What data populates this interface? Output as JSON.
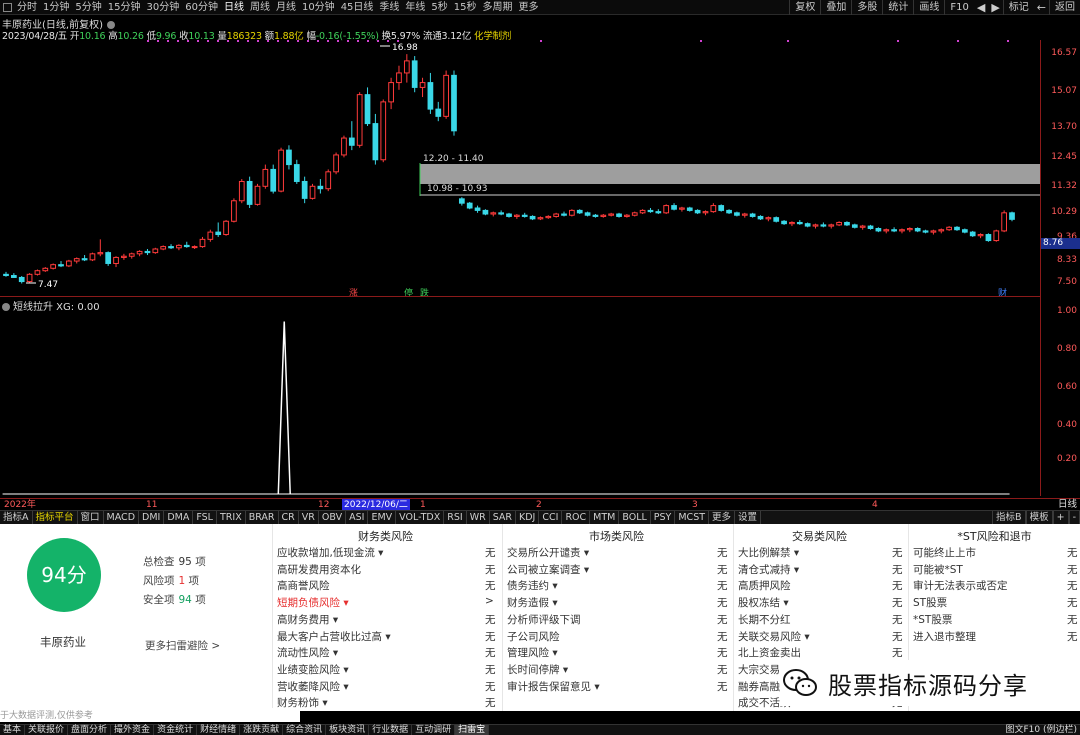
{
  "toolbar": {
    "periods": [
      "分时",
      "1分钟",
      "5分钟",
      "15分钟",
      "30分钟",
      "60分钟",
      "日线",
      "周线",
      "月线",
      "10分钟",
      "45日线",
      "季线",
      "年线",
      "5秒",
      "15秒",
      "多周期",
      "更多"
    ],
    "active_period": "日线",
    "right_buttons": [
      "复权",
      "叠加",
      "多股",
      "统计",
      "画线",
      "F10",
      "标记",
      "返回"
    ]
  },
  "stock": {
    "title": "丰原药业(日线,前复权)",
    "info": {
      "date": "2023/04/28/五",
      "open_label": "开",
      "open": "10.16",
      "high_label": "高",
      "high": "10.26",
      "low_label": "低",
      "low": "9.96",
      "close_label": "收",
      "close": "10.13",
      "vol_label": "量",
      "vol": "186323",
      "amt_label": "额",
      "amt": "1.88亿",
      "chg_label": "幅",
      "chg": "-0.16(-1.55%)",
      "turn_label": "换",
      "turn": "5.97%",
      "float_label": "流通",
      "float": "3.12亿",
      "sector": "化学制剂"
    },
    "price_high_marker": "16.98",
    "price_low_marker": "7.47",
    "zone_upper_label": "12.20 - 11.40",
    "zone_lower_label": "10.98 - 10.93",
    "current_price": "8.76",
    "event_markers": [
      {
        "text": "涨",
        "color": "#ff4040"
      },
      {
        "text": "停",
        "color": "#3fd15a"
      },
      {
        "text": "跌",
        "color": "#3fd15a"
      },
      {
        "text": "财",
        "color": "#4080ff"
      }
    ]
  },
  "y_axis": [
    "16.57",
    "15.07",
    "13.70",
    "12.45",
    "11.32",
    "10.29",
    "9.36",
    "8.33",
    "7.50"
  ],
  "sub_chart": {
    "title": "短线拉升 XG: 0.00",
    "y_axis": [
      "1.00",
      "0.80",
      "0.60",
      "0.40",
      "0.20"
    ]
  },
  "date_axis": {
    "labels": [
      "2022年",
      "11",
      "12",
      "1",
      "2",
      "3",
      "4"
    ],
    "highlight": "2022/12/06/二",
    "unit": "日线"
  },
  "indicator_tabs": [
    "指标A",
    "指标平台",
    "窗口",
    "MACD",
    "DMI",
    "DMA",
    "FSL",
    "TRIX",
    "BRAR",
    "CR",
    "VR",
    "OBV",
    "ASI",
    "EMV",
    "VOL-TDX",
    "RSI",
    "WR",
    "SAR",
    "KDJ",
    "CCI",
    "ROC",
    "MTM",
    "BOLL",
    "PSY",
    "MCST",
    "更多",
    "设置"
  ],
  "indicator_tabs_right": [
    "指标B",
    "模板",
    "+",
    "-"
  ],
  "risk_panel": {
    "score": "94分",
    "company": "丰原药业",
    "total_label": "总检查",
    "total": "95",
    "total_unit": "项",
    "risk_label": "风险项",
    "risk": "1",
    "risk_unit": "项",
    "safe_label": "安全项",
    "safe": "94",
    "safe_unit": "项",
    "more": "更多扫雷避险 >",
    "disclaimer": "于大数据评测,仅供参考",
    "columns": [
      {
        "title": "财务类风险",
        "items": [
          {
            "label": "应收款增加,低现金流 ▾",
            "value": "无"
          },
          {
            "label": "高研发费用资本化",
            "value": "无"
          },
          {
            "label": "高商誉风险",
            "value": "无"
          },
          {
            "label": "短期负债风险 ▾",
            "value": ">",
            "alert": true
          },
          {
            "label": "高财务费用 ▾",
            "value": "无"
          },
          {
            "label": "最大客户占营收比过高 ▾",
            "value": "无"
          },
          {
            "label": "流动性风险 ▾",
            "value": "无"
          },
          {
            "label": "业绩变脸风险 ▾",
            "value": "无"
          },
          {
            "label": "营收萎降风险 ▾",
            "value": "无"
          },
          {
            "label": "财务粉饰 ▾",
            "value": "无"
          }
        ]
      },
      {
        "title": "市场类风险",
        "items": [
          {
            "label": "交易所公开谴责 ▾",
            "value": "无"
          },
          {
            "label": "公司被立案调查 ▾",
            "value": "无"
          },
          {
            "label": "债务违约 ▾",
            "value": "无"
          },
          {
            "label": "财务造假 ▾",
            "value": "无"
          },
          {
            "label": "分析师评级下调",
            "value": "无"
          },
          {
            "label": "子公司风险",
            "value": "无"
          },
          {
            "label": "管理风险 ▾",
            "value": "无"
          },
          {
            "label": "长时间停牌 ▾",
            "value": "无"
          },
          {
            "label": "审计报告保留意见 ▾",
            "value": "无"
          }
        ]
      },
      {
        "title": "交易类风险",
        "items": [
          {
            "label": "大比例解禁 ▾",
            "value": "无"
          },
          {
            "label": "清仓式减持 ▾",
            "value": "无"
          },
          {
            "label": "高质押风险",
            "value": "无"
          },
          {
            "label": "股权冻结 ▾",
            "value": "无"
          },
          {
            "label": "长期不分红",
            "value": "无"
          },
          {
            "label": "关联交易风险 ▾",
            "value": "无"
          },
          {
            "label": "北上资金卖出",
            "value": "无"
          },
          {
            "label": "大宗交易",
            "value": "无"
          },
          {
            "label": "融券高融",
            "value": "无"
          },
          {
            "label": "成交不活跃 ▾",
            "value": "无"
          }
        ]
      },
      {
        "title": "*ST风险和退市",
        "items": [
          {
            "label": "可能终止上市",
            "value": "无"
          },
          {
            "label": "可能被*ST",
            "value": "无"
          },
          {
            "label": "审计无法表示或否定",
            "value": "无"
          },
          {
            "label": "ST股票",
            "value": "无"
          },
          {
            "label": "*ST股票",
            "value": "无"
          },
          {
            "label": "进入退市整理",
            "value": "无"
          }
        ]
      }
    ]
  },
  "watermark": "股票指标源码分享",
  "status_bar": [
    "基本",
    "关联报价",
    "盘面分析",
    "撮外资金",
    "资金统计",
    "财经情绪",
    "涨跌贡献",
    "综合资讯",
    "板块资讯",
    "行业数据",
    "互动调研",
    "扫雷宝"
  ],
  "status_active": "扫雷宝",
  "status_right": "图文F10 (例边栏)",
  "chart_data": {
    "type": "candlestick",
    "title": "丰原药业(日线,前复权)",
    "ylim": [
      7.2,
      17.4
    ],
    "y_ticks": [
      16.57,
      15.07,
      13.7,
      12.45,
      11.32,
      10.29,
      9.36,
      8.33,
      7.5
    ],
    "candles": [
      [
        7.85,
        7.95,
        7.75,
        7.8
      ],
      [
        7.8,
        7.9,
        7.7,
        7.72
      ],
      [
        7.72,
        7.78,
        7.47,
        7.55
      ],
      [
        7.55,
        7.9,
        7.5,
        7.85
      ],
      [
        7.85,
        8.05,
        7.8,
        8.0
      ],
      [
        8.0,
        8.15,
        7.95,
        8.1
      ],
      [
        8.1,
        8.3,
        8.05,
        8.25
      ],
      [
        8.25,
        8.4,
        8.15,
        8.2
      ],
      [
        8.2,
        8.45,
        8.15,
        8.4
      ],
      [
        8.4,
        8.55,
        8.3,
        8.5
      ],
      [
        8.5,
        8.65,
        8.4,
        8.45
      ],
      [
        8.45,
        8.75,
        8.4,
        8.7
      ],
      [
        8.7,
        9.3,
        8.6,
        8.75
      ],
      [
        8.75,
        8.8,
        8.2,
        8.3
      ],
      [
        8.3,
        8.6,
        8.15,
        8.55
      ],
      [
        8.55,
        8.7,
        8.45,
        8.6
      ],
      [
        8.6,
        8.75,
        8.5,
        8.7
      ],
      [
        8.7,
        8.85,
        8.6,
        8.8
      ],
      [
        8.8,
        8.9,
        8.65,
        8.75
      ],
      [
        8.75,
        8.95,
        8.7,
        8.9
      ],
      [
        8.9,
        9.05,
        8.85,
        9.0
      ],
      [
        9.0,
        9.1,
        8.9,
        8.95
      ],
      [
        8.95,
        9.1,
        8.85,
        9.05
      ],
      [
        9.05,
        9.2,
        8.95,
        9.0
      ],
      [
        9.0,
        9.05,
        8.9,
        9.0
      ],
      [
        9.0,
        9.4,
        8.95,
        9.3
      ],
      [
        9.3,
        9.7,
        9.2,
        9.6
      ],
      [
        9.6,
        10.0,
        9.4,
        9.5
      ],
      [
        9.5,
        10.1,
        9.45,
        10.05
      ],
      [
        10.05,
        11.0,
        10.0,
        10.9
      ],
      [
        10.9,
        11.8,
        10.8,
        11.7
      ],
      [
        11.7,
        11.9,
        10.6,
        10.75
      ],
      [
        10.75,
        11.6,
        10.7,
        11.5
      ],
      [
        11.5,
        12.4,
        11.4,
        12.2
      ],
      [
        12.2,
        12.4,
        11.2,
        11.3
      ],
      [
        11.3,
        13.1,
        11.25,
        13.0
      ],
      [
        13.0,
        13.2,
        12.2,
        12.4
      ],
      [
        12.4,
        12.6,
        11.6,
        11.7
      ],
      [
        11.7,
        11.9,
        10.8,
        11.0
      ],
      [
        11.0,
        11.6,
        10.95,
        11.5
      ],
      [
        11.5,
        11.8,
        11.2,
        11.4
      ],
      [
        11.4,
        12.2,
        11.3,
        12.1
      ],
      [
        12.1,
        12.9,
        12.0,
        12.8
      ],
      [
        12.8,
        13.6,
        12.7,
        13.5
      ],
      [
        13.5,
        14.2,
        13.0,
        13.2
      ],
      [
        13.2,
        15.4,
        13.1,
        15.3
      ],
      [
        15.3,
        15.6,
        14.0,
        14.1
      ],
      [
        14.1,
        14.5,
        12.4,
        12.6
      ],
      [
        12.6,
        15.1,
        12.5,
        15.0
      ],
      [
        15.0,
        16.0,
        14.7,
        15.8
      ],
      [
        15.8,
        16.5,
        15.5,
        16.2
      ],
      [
        16.2,
        16.98,
        15.8,
        16.7
      ],
      [
        16.7,
        16.9,
        15.4,
        15.6
      ],
      [
        15.6,
        16.0,
        15.2,
        15.8
      ],
      [
        15.8,
        16.2,
        14.5,
        14.7
      ],
      [
        14.7,
        15.0,
        14.2,
        14.4
      ],
      [
        14.4,
        16.3,
        14.3,
        16.1
      ],
      [
        16.1,
        16.3,
        13.6,
        13.8
      ],
      [
        10.98,
        11.05,
        10.7,
        10.8
      ],
      [
        10.8,
        10.85,
        10.55,
        10.6
      ],
      [
        10.6,
        10.7,
        10.4,
        10.5
      ],
      [
        10.5,
        10.55,
        10.3,
        10.35
      ],
      [
        10.35,
        10.45,
        10.25,
        10.4
      ],
      [
        10.4,
        10.5,
        10.3,
        10.35
      ],
      [
        10.35,
        10.4,
        10.2,
        10.25
      ],
      [
        10.25,
        10.35,
        10.15,
        10.3
      ],
      [
        10.3,
        10.4,
        10.2,
        10.25
      ],
      [
        10.25,
        10.3,
        10.1,
        10.15
      ],
      [
        10.15,
        10.25,
        10.1,
        10.2
      ],
      [
        10.2,
        10.3,
        10.15,
        10.25
      ],
      [
        10.25,
        10.4,
        10.2,
        10.35
      ],
      [
        10.35,
        10.45,
        10.25,
        10.3
      ],
      [
        10.3,
        10.55,
        10.25,
        10.5
      ],
      [
        10.5,
        10.55,
        10.35,
        10.4
      ],
      [
        10.4,
        10.45,
        10.25,
        10.3
      ],
      [
        10.3,
        10.35,
        10.2,
        10.25
      ],
      [
        10.25,
        10.35,
        10.2,
        10.3
      ],
      [
        10.3,
        10.4,
        10.25,
        10.35
      ],
      [
        10.35,
        10.4,
        10.2,
        10.25
      ],
      [
        10.25,
        10.35,
        10.2,
        10.3
      ],
      [
        10.3,
        10.45,
        10.25,
        10.4
      ],
      [
        10.4,
        10.55,
        10.35,
        10.5
      ],
      [
        10.5,
        10.6,
        10.4,
        10.45
      ],
      [
        10.45,
        10.55,
        10.35,
        10.4
      ],
      [
        10.4,
        10.75,
        10.35,
        10.7
      ],
      [
        10.7,
        10.8,
        10.5,
        10.55
      ],
      [
        10.55,
        10.65,
        10.45,
        10.6
      ],
      [
        10.6,
        10.65,
        10.45,
        10.5
      ],
      [
        10.5,
        10.55,
        10.35,
        10.4
      ],
      [
        10.4,
        10.5,
        10.3,
        10.45
      ],
      [
        10.45,
        10.8,
        10.4,
        10.7
      ],
      [
        10.7,
        10.75,
        10.45,
        10.5
      ],
      [
        10.5,
        10.55,
        10.35,
        10.4
      ],
      [
        10.4,
        10.45,
        10.25,
        10.3
      ],
      [
        10.3,
        10.4,
        10.2,
        10.35
      ],
      [
        10.35,
        10.4,
        10.2,
        10.25
      ],
      [
        10.25,
        10.3,
        10.1,
        10.15
      ],
      [
        10.15,
        10.25,
        10.05,
        10.2
      ],
      [
        10.2,
        10.25,
        10.0,
        10.05
      ],
      [
        10.05,
        10.1,
        9.9,
        9.95
      ],
      [
        9.95,
        10.05,
        9.85,
        10.0
      ],
      [
        10.0,
        10.1,
        9.9,
        9.95
      ],
      [
        9.95,
        10.0,
        9.8,
        9.85
      ],
      [
        9.85,
        9.95,
        9.75,
        9.9
      ],
      [
        9.9,
        10.0,
        9.8,
        9.85
      ],
      [
        9.85,
        9.95,
        9.75,
        9.9
      ],
      [
        9.9,
        10.05,
        9.85,
        10.0
      ],
      [
        10.0,
        10.05,
        9.85,
        9.9
      ],
      [
        9.9,
        9.95,
        9.75,
        9.8
      ],
      [
        9.8,
        9.9,
        9.7,
        9.85
      ],
      [
        9.85,
        9.9,
        9.7,
        9.75
      ],
      [
        9.75,
        9.8,
        9.6,
        9.65
      ],
      [
        9.65,
        9.75,
        9.55,
        9.7
      ],
      [
        9.7,
        9.8,
        9.6,
        9.65
      ],
      [
        9.65,
        9.75,
        9.55,
        9.7
      ],
      [
        9.7,
        9.8,
        9.6,
        9.75
      ],
      [
        9.75,
        9.8,
        9.6,
        9.65
      ],
      [
        9.65,
        9.7,
        9.55,
        9.6
      ],
      [
        9.6,
        9.7,
        9.5,
        9.65
      ],
      [
        9.65,
        9.75,
        9.55,
        9.7
      ],
      [
        9.7,
        9.85,
        9.65,
        9.8
      ],
      [
        9.8,
        9.85,
        9.65,
        9.7
      ],
      [
        9.7,
        9.75,
        9.55,
        9.6
      ],
      [
        9.6,
        9.65,
        9.4,
        9.45
      ],
      [
        9.45,
        9.55,
        9.35,
        9.5
      ],
      [
        9.5,
        9.55,
        9.2,
        9.25
      ],
      [
        9.25,
        9.7,
        9.2,
        9.65
      ],
      [
        9.65,
        10.5,
        9.6,
        10.4
      ],
      [
        10.4,
        10.45,
        10.05,
        10.13
      ]
    ],
    "sub_series": {
      "name": "XG",
      "ylim": [
        0,
        1.05
      ],
      "spike_index": 35,
      "spike_value": 1.0
    }
  }
}
